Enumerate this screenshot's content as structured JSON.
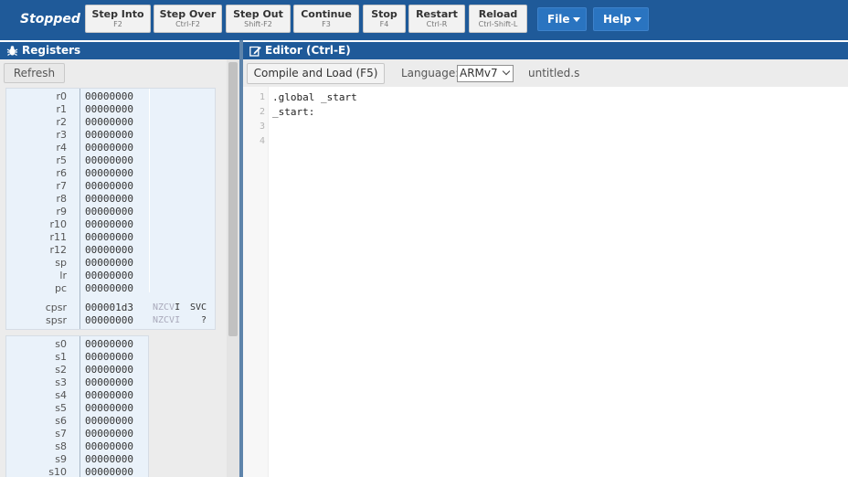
{
  "toolbar": {
    "status": "Stopped",
    "buttons": [
      {
        "label": "Step Into",
        "key": "F2"
      },
      {
        "label": "Step Over",
        "key": "Ctrl-F2"
      },
      {
        "label": "Step Out",
        "key": "Shift-F2"
      },
      {
        "label": "Continue",
        "key": "F3"
      },
      {
        "label": "Stop",
        "key": "F4"
      },
      {
        "label": "Restart",
        "key": "Ctrl-R"
      },
      {
        "label": "Reload",
        "key": "Ctrl-Shift-L"
      }
    ],
    "menus": [
      {
        "label": "File"
      },
      {
        "label": "Help"
      }
    ],
    "colors": {
      "bar": "#1f5a99",
      "menu": "#2a74c0"
    }
  },
  "registers_panel": {
    "title": "Registers",
    "refresh_label": "Refresh",
    "registers": [
      {
        "name": "r0",
        "value": "00000000"
      },
      {
        "name": "r1",
        "value": "00000000"
      },
      {
        "name": "r2",
        "value": "00000000"
      },
      {
        "name": "r3",
        "value": "00000000"
      },
      {
        "name": "r4",
        "value": "00000000"
      },
      {
        "name": "r5",
        "value": "00000000"
      },
      {
        "name": "r6",
        "value": "00000000"
      },
      {
        "name": "r7",
        "value": "00000000"
      },
      {
        "name": "r8",
        "value": "00000000"
      },
      {
        "name": "r9",
        "value": "00000000"
      },
      {
        "name": "r10",
        "value": "00000000"
      },
      {
        "name": "r11",
        "value": "00000000"
      },
      {
        "name": "r12",
        "value": "00000000"
      },
      {
        "name": "sp",
        "value": "00000000"
      },
      {
        "name": "lr",
        "value": "00000000"
      },
      {
        "name": "pc",
        "value": "00000000"
      }
    ],
    "status_registers": [
      {
        "name": "cpsr",
        "value": "000001d3",
        "flags_off": "NZCV",
        "flags_on": "I",
        "mode": "SVC"
      },
      {
        "name": "spsr",
        "value": "00000000",
        "flags_off": "NZCVI",
        "flags_on": "",
        "mode": "?"
      }
    ],
    "vfp_registers": [
      {
        "name": "s0",
        "value": "00000000"
      },
      {
        "name": "s1",
        "value": "00000000"
      },
      {
        "name": "s2",
        "value": "00000000"
      },
      {
        "name": "s3",
        "value": "00000000"
      },
      {
        "name": "s4",
        "value": "00000000"
      },
      {
        "name": "s5",
        "value": "00000000"
      },
      {
        "name": "s6",
        "value": "00000000"
      },
      {
        "name": "s7",
        "value": "00000000"
      },
      {
        "name": "s8",
        "value": "00000000"
      },
      {
        "name": "s9",
        "value": "00000000"
      },
      {
        "name": "s10",
        "value": "00000000"
      }
    ]
  },
  "editor_panel": {
    "title": "Editor (Ctrl-E)",
    "compile_label": "Compile and Load (F5)",
    "language_label": "Language:",
    "language_selected": "ARMv7",
    "filename": "untitled.s",
    "lines": [
      {
        "num": "1",
        "text": ".global _start"
      },
      {
        "num": "2",
        "text": "_start:"
      },
      {
        "num": "3",
        "text": ""
      },
      {
        "num": "4",
        "text": ""
      }
    ]
  }
}
